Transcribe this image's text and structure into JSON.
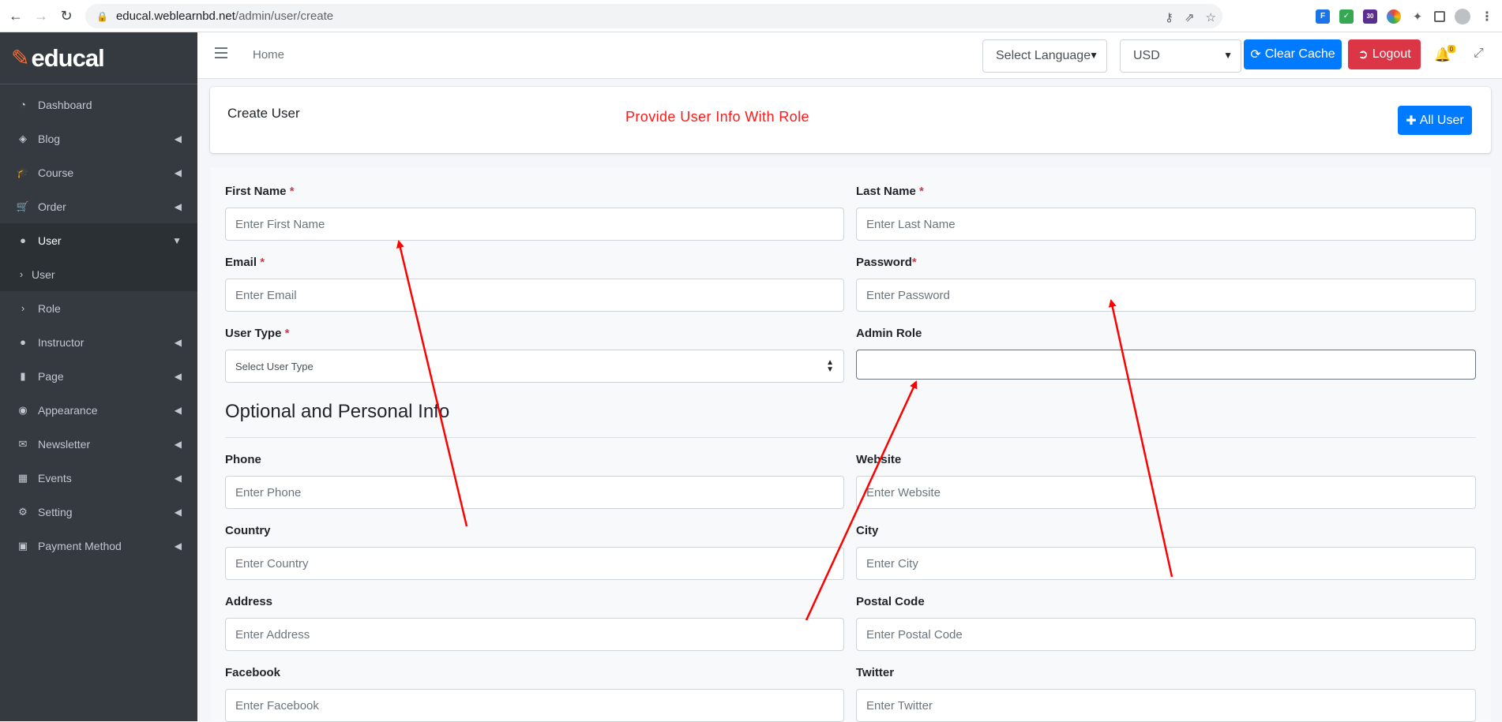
{
  "browser": {
    "url_host": "educal.weblearnbd.net",
    "url_path": "/admin/user/create",
    "ext_badge": "30"
  },
  "brand": {
    "name": "educal"
  },
  "sidebar": {
    "items": [
      {
        "label": "Dashboard",
        "icon": "dashboard-icon",
        "caret": false
      },
      {
        "label": "Blog",
        "icon": "blog-icon",
        "caret": true
      },
      {
        "label": "Course",
        "icon": "course-icon",
        "caret": true
      },
      {
        "label": "Order",
        "icon": "cart-icon",
        "caret": true
      },
      {
        "label": "User",
        "icon": "user-icon",
        "caret": true,
        "expanded": true
      },
      {
        "label": "User",
        "icon": "chevron-right-icon",
        "sub": true
      },
      {
        "label": "Role",
        "icon": "chevron-right-icon",
        "sub": true
      },
      {
        "label": "Instructor",
        "icon": "instructor-icon",
        "caret": true
      },
      {
        "label": "Page",
        "icon": "page-icon",
        "caret": true
      },
      {
        "label": "Appearance",
        "icon": "palette-icon",
        "caret": true
      },
      {
        "label": "Newsletter",
        "icon": "envelope-icon",
        "caret": true
      },
      {
        "label": "Events",
        "icon": "calendar-icon",
        "caret": true
      },
      {
        "label": "Setting",
        "icon": "gear-icon",
        "caret": true
      },
      {
        "label": "Payment Method",
        "icon": "payment-icon",
        "caret": true
      }
    ]
  },
  "topnav": {
    "home": "Home",
    "language_select": "Select Language",
    "currency_select": "USD",
    "clear_cache": "Clear Cache",
    "logout": "Logout",
    "notification_count": "0"
  },
  "header": {
    "title": "Create User",
    "annotation": "Provide User Info With Role",
    "all_user_button": "All User"
  },
  "form": {
    "first_name_label": "First Name",
    "first_name_placeholder": "Enter First Name",
    "last_name_label": "Last Name",
    "last_name_placeholder": "Enter Last Name",
    "email_label": "Email",
    "email_placeholder": "Enter Email",
    "password_label": "Password",
    "password_placeholder": "Enter Password",
    "user_type_label": "User Type",
    "user_type_value": "Select User Type",
    "admin_role_label": "Admin Role",
    "admin_role_value": "",
    "required_mark": "*",
    "section_title": "Optional and Personal Info",
    "phone_label": "Phone",
    "phone_placeholder": "Enter Phone",
    "website_label": "Website",
    "website_placeholder": "Enter Website",
    "country_label": "Country",
    "country_placeholder": "Enter Country",
    "city_label": "City",
    "city_placeholder": "Enter City",
    "address_label": "Address",
    "address_placeholder": "Enter Address",
    "postal_code_label": "Postal Code",
    "postal_code_placeholder": "Enter Postal Code",
    "facebook_label": "Facebook",
    "facebook_placeholder": "Enter Facebook",
    "twitter_label": "Twitter",
    "twitter_placeholder": "Enter Twitter"
  },
  "colors": {
    "sidebar_bg": "#343a40",
    "primary": "#007bff",
    "danger": "#dc3545",
    "annotation_red": "#ff1a1a"
  }
}
